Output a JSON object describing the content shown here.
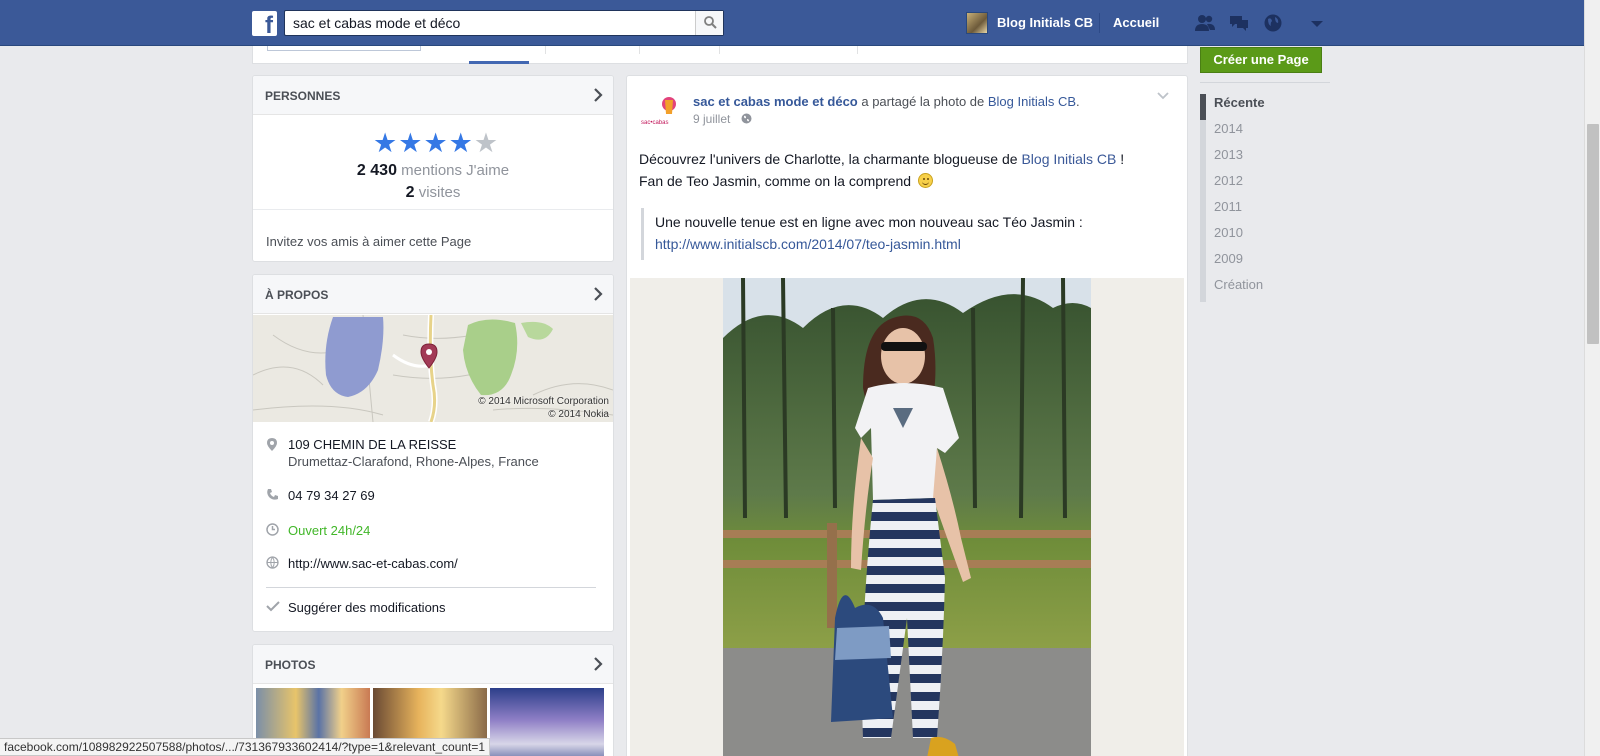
{
  "topbar": {
    "logo": "f",
    "search_value": "sac et cabas mode et déco",
    "user_name": "Blog Initials CB",
    "home": "Accueil"
  },
  "create_page": "Créer une Page",
  "people_card": {
    "title": "PERSONNES",
    "rating_stars": 4,
    "likes_count": "2 430",
    "likes_label": "mentions J'aime",
    "visits_count": "2",
    "visits_label": "visites",
    "invite": "Invitez vos amis à aimer cette Page"
  },
  "about_card": {
    "title": "À PROPOS",
    "map_credit_1": "© 2014 Microsoft Corporation",
    "map_credit_2": "© 2014 Nokia",
    "address_line1": "109 CHEMIN DE LA REISSE",
    "address_line2": "Drumettaz-Clarafond, Rhone-Alpes, France",
    "phone": "04 79 34 27 69",
    "hours": "Ouvert 24h/24",
    "website": "http://www.sac-et-cabas.com/",
    "suggest": "Suggérer des modifications"
  },
  "photos_card": {
    "title": "PHOTOS"
  },
  "post": {
    "author": "sac et cabas mode et déco",
    "action": " a partagé la photo de ",
    "shared_from": "Blog Initials CB",
    "period": ".",
    "date": "9 juillet",
    "text1_before": "Découvrez l'univers de Charlotte, la charmante blogueuse de ",
    "text1_link": "Blog Initials CB",
    "text1_after": " !",
    "text2": "Fan de Teo Jasmin, comme on la comprend",
    "quote1": "Une nouvelle tenue est en ligne avec mon nouveau sac Téo Jasmin :",
    "quote2": "http://www.initialscb.com/2014/07/teo-jasmin.html"
  },
  "timeline": [
    "Récente",
    "2014",
    "2013",
    "2012",
    "2011",
    "2010",
    "2009",
    "Création"
  ],
  "statusbar": "facebook.com/108982922507588/photos/.../731367933602414/?type=1&relevant_count=1",
  "colors": {
    "brand": "#3b5998",
    "create_btn": "#5b9a18",
    "star": "#3578e5",
    "open": "#42b72a"
  }
}
